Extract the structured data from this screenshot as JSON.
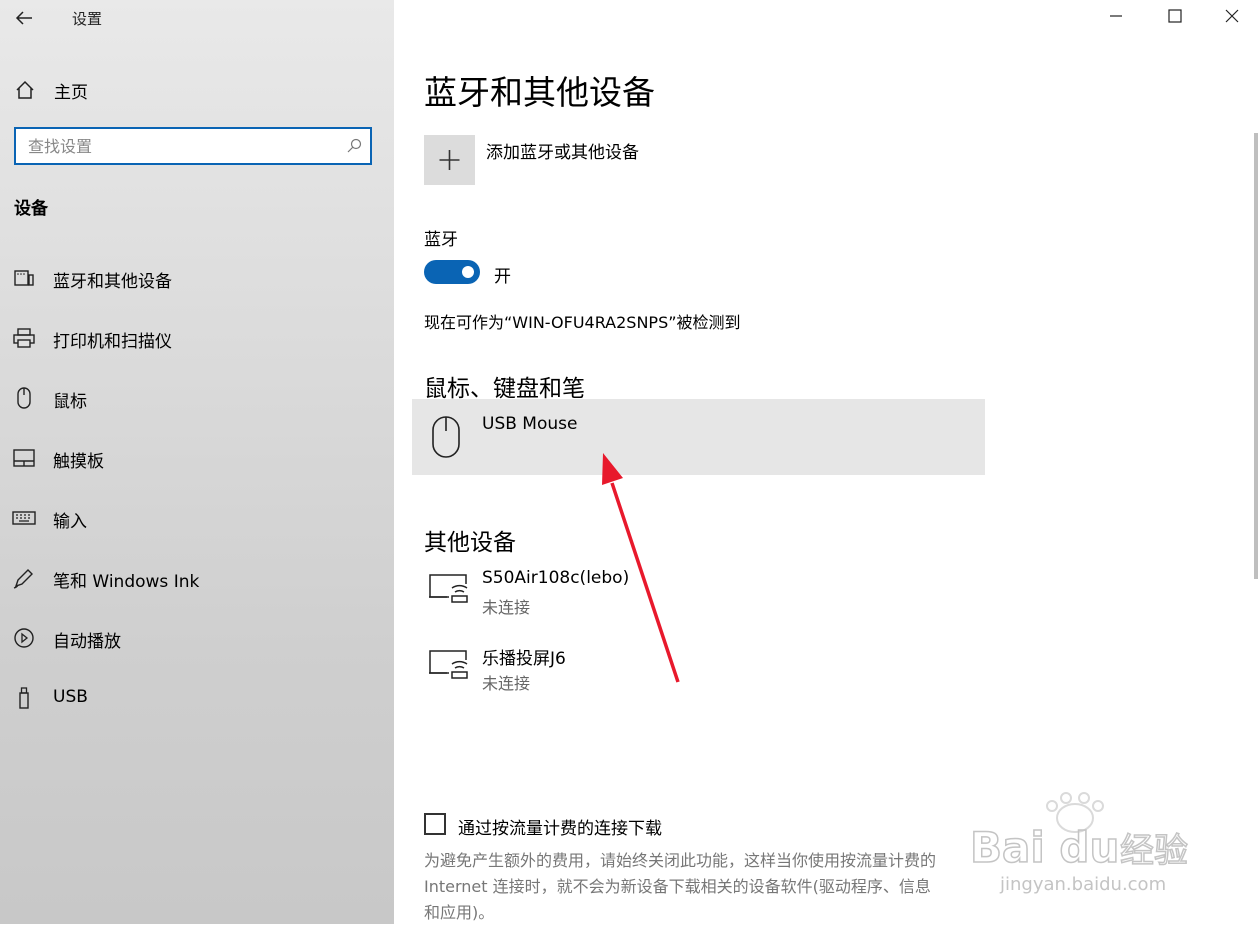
{
  "window": {
    "app_title": "设置"
  },
  "sidebar": {
    "home_label": "主页",
    "search": {
      "placeholder": "查找设置",
      "value": ""
    },
    "section_title": "设备",
    "items": [
      {
        "label": "蓝牙和其他设备",
        "icon": "bluetooth-device-icon"
      },
      {
        "label": "打印机和扫描仪",
        "icon": "printer-icon"
      },
      {
        "label": "鼠标",
        "icon": "mouse-icon"
      },
      {
        "label": "触摸板",
        "icon": "touchpad-icon"
      },
      {
        "label": "输入",
        "icon": "keyboard-icon"
      },
      {
        "label": "笔和 Windows Ink",
        "icon": "pen-icon"
      },
      {
        "label": "自动播放",
        "icon": "autoplay-icon"
      },
      {
        "label": "USB",
        "icon": "usb-icon"
      }
    ]
  },
  "main": {
    "page_title": "蓝牙和其他设备",
    "add_device_label": "添加蓝牙或其他设备",
    "bluetooth_label": "蓝牙",
    "bluetooth_state": "开",
    "discoverable_text": "现在可作为“WIN-OFU4RA2SNPS”被检测到",
    "mouse_group_title": "鼠标、键盘和笔",
    "mouse_device": {
      "name": "USB Mouse"
    },
    "other_group_title": "其他设备",
    "other_devices": [
      {
        "name": "S50Air108c(lebo)",
        "status": "未连接"
      },
      {
        "name": "乐播投屏J6",
        "status": "未连接"
      }
    ],
    "metered_checkbox_label": "通过按流量计费的连接下载",
    "metered_checkbox_checked": false,
    "metered_description_lines": [
      "为避免产生额外的费用，请始终关闭此功能，这样当你使用按流量计费的",
      "Internet 连接时，就不会为新设备下载相关的设备软件(驱动程序、信息",
      "和应用)。"
    ]
  },
  "watermark": {
    "brand": "Bai du",
    "label": "经验",
    "url": "jingyan.baidu.com"
  },
  "colors": {
    "accent": "#0a64b4",
    "arrow": "#e8192c"
  }
}
